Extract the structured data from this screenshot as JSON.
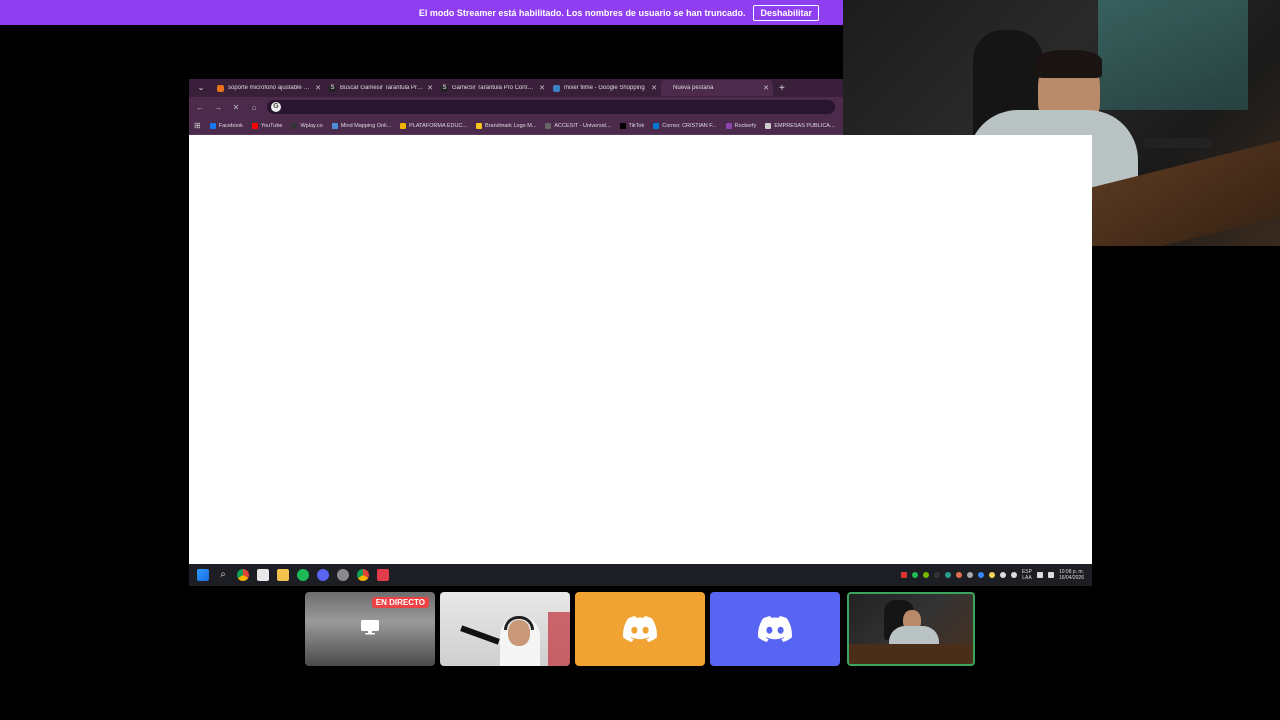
{
  "banner": {
    "message": "El modo Streamer está habilitado. Los nombres de usuario se han truncado.",
    "button_label": "Deshabilitar"
  },
  "browser": {
    "tabs": [
      {
        "title": "soporte microfono ajustable c...",
        "favicon_color": "#e8711a"
      },
      {
        "title": "Buscar Gamesir Tarantula Pro ...",
        "favicon_color": "#222222"
      },
      {
        "title": "GameSir Tarantula Pro Control...",
        "favicon_color": "#222222"
      },
      {
        "title": "mixer filme - Google Shopping",
        "favicon_color": "#3b82c4"
      },
      {
        "title": "Nueva pestaña",
        "favicon_color": "none"
      }
    ],
    "new_tab_label": "+",
    "bookmarks": [
      {
        "label": "Facebook",
        "color": "#1877f2"
      },
      {
        "label": "YouTube",
        "color": "#ff0000"
      },
      {
        "label": "Wplay.co",
        "color": "#333333"
      },
      {
        "label": "Mind Mapping Onli...",
        "color": "#4a90d9"
      },
      {
        "label": "PLATAFORMA EDUC...",
        "color": "#f0b400"
      },
      {
        "label": "Brandmark Logo M...",
        "color": "#f5c518"
      },
      {
        "label": "ACCESIT - Universid...",
        "color": "#666666"
      },
      {
        "label": "TikTok",
        "color": "#000000"
      },
      {
        "label": "Correo: CRISTIAN F...",
        "color": "#0078d4"
      },
      {
        "label": "Rockerfy",
        "color": "#8e44ad"
      },
      {
        "label": "EMPRESAS PUBLICA...",
        "color": "#cccccc"
      }
    ]
  },
  "taskbar": {
    "language": "ESP",
    "region": "LAA",
    "time": "10:08 p. m.",
    "date": "16/04/2026"
  },
  "tiles": {
    "live_label": "EN DIRECTO"
  }
}
